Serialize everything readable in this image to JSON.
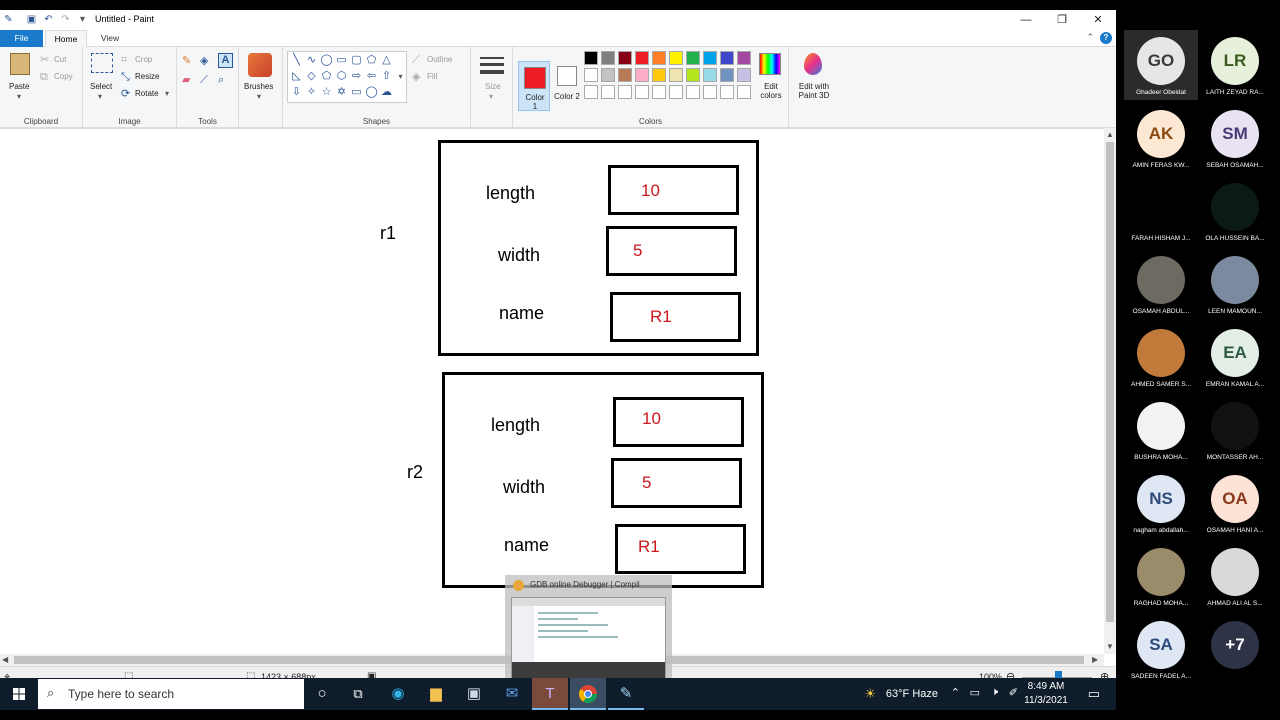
{
  "paint": {
    "title": "Untitled - Paint",
    "tabs": [
      "File",
      "Home",
      "View"
    ],
    "ribbon": {
      "clipboard": {
        "paste": "Paste",
        "cut": "Cut",
        "copy": "Copy",
        "label": "Clipboard"
      },
      "image": {
        "select": "Select",
        "crop": "Crop",
        "resize": "Resize",
        "rotate": "Rotate",
        "label": "Image"
      },
      "tools": {
        "label": "Tools"
      },
      "brushes": {
        "label": "Brushes"
      },
      "shapes": {
        "outline": "Outline",
        "fill": "Fill",
        "label": "Shapes"
      },
      "size": {
        "label": "Size"
      },
      "colors": {
        "color1": "Color 1",
        "color2": "Color 2",
        "edit_colors": "Edit colors",
        "label": "Colors",
        "color1_value": "#ed1c24",
        "color2_value": "#ffffff",
        "palette": [
          "#000000",
          "#7f7f7f",
          "#880015",
          "#ed1c24",
          "#ff7f27",
          "#fff200",
          "#22b14c",
          "#00a2e8",
          "#3f48cc",
          "#a349a4",
          "#ffffff",
          "#c3c3c3",
          "#b97a57",
          "#ffaec9",
          "#ffc90e",
          "#efe4b0",
          "#b5e61d",
          "#99d9ea",
          "#7092be",
          "#c8bfe7",
          "#ffffff",
          "#ffffff",
          "#ffffff",
          "#ffffff",
          "#ffffff",
          "#ffffff",
          "#ffffff",
          "#ffffff",
          "#ffffff",
          "#ffffff"
        ]
      },
      "paint3d": "Edit with Paint 3D"
    },
    "status": {
      "dimensions": "1423 × 688px",
      "zoom": "100%"
    }
  },
  "drawing": {
    "objects": [
      {
        "name": "r1",
        "fields": [
          {
            "label": "length",
            "value": "10"
          },
          {
            "label": "width",
            "value": "5"
          },
          {
            "label": "name",
            "value": "R1"
          }
        ]
      },
      {
        "name": "r2",
        "fields": [
          {
            "label": "length",
            "value": "10"
          },
          {
            "label": "width",
            "value": "5"
          },
          {
            "label": "name",
            "value": "R1"
          }
        ]
      }
    ]
  },
  "thumbnail": {
    "title": "GDB online Debugger | Compil"
  },
  "taskbar": {
    "search_placeholder": "Type here to search",
    "weather": "63°F  Haze",
    "time": "8:49 AM",
    "date": "11/3/2021"
  },
  "participants": [
    {
      "initials": "GO",
      "name": "Ghadeer Obeidat",
      "bg": "#e6e6e6",
      "fg": "#3a3a3a"
    },
    {
      "initials": "LR",
      "name": "LAITH ZEYAD RA...",
      "bg": "#e6f0da",
      "fg": "#3b5a1f"
    },
    {
      "initials": "AK",
      "name": "AMIN FERAS KW...",
      "bg": "#fde8d3",
      "fg": "#8a4a12"
    },
    {
      "initials": "SM",
      "name": "SEBAH OSAMAH...",
      "bg": "#e8e2f3",
      "fg": "#4b3a75"
    },
    {
      "initials": "",
      "name": "FARAH HISHAM J...",
      "bg": "#000000",
      "fg": "#cccccc"
    },
    {
      "initials": "",
      "name": "OLA HUSSEIN BA...",
      "bg": "#0b1a14",
      "fg": "#5fd0b0"
    },
    {
      "initials": "",
      "name": "OSAMAH ABDUL...",
      "bg": "#6d6a62",
      "fg": "#ffffff"
    },
    {
      "initials": "",
      "name": "LEEN MAMOUN...",
      "bg": "#7c8aa0",
      "fg": "#ffffff"
    },
    {
      "initials": "",
      "name": "AHMED SAMER S...",
      "bg": "#c27a3a",
      "fg": "#ffffff"
    },
    {
      "initials": "EA",
      "name": "EMRAN KAMAL A...",
      "bg": "#e2eee6",
      "fg": "#2f5a3f"
    },
    {
      "initials": "",
      "name": "BUSHRA MOHA...",
      "bg": "#f2f2f2",
      "fg": "#333333"
    },
    {
      "initials": "",
      "name": "MONTASSER AH...",
      "bg": "#111111",
      "fg": "#ffffff"
    },
    {
      "initials": "NS",
      "name": "nagham abdallah...",
      "bg": "#dfe7f5",
      "fg": "#2d4a7a"
    },
    {
      "initials": "OA",
      "name": "OSAMAH HANI A...",
      "bg": "#fde3d6",
      "fg": "#8a3a1a"
    },
    {
      "initials": "",
      "name": "RAGHAD MOHA...",
      "bg": "#9a8c6a",
      "fg": "#ffffff"
    },
    {
      "initials": "",
      "name": "AHMAD ALI AL S...",
      "bg": "#d9d9d9",
      "fg": "#333333"
    },
    {
      "initials": "SA",
      "name": "SADEEN FADEL A...",
      "bg": "#dfe7f5",
      "fg": "#2d4a7a"
    },
    {
      "initials": "+7",
      "name": "",
      "bg": "#2e3347",
      "fg": "#ffffff"
    }
  ]
}
